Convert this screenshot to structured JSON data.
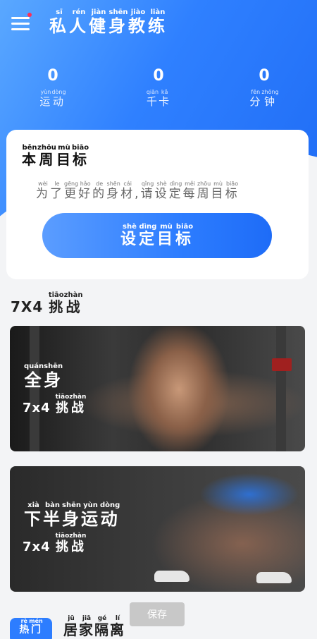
{
  "header": {
    "title_chars": [
      {
        "han": "私",
        "py": "sī"
      },
      {
        "han": "人",
        "py": "rén"
      },
      {
        "han": "健",
        "py": "jiàn"
      },
      {
        "han": "身",
        "py": "shēn"
      },
      {
        "han": "教",
        "py": "jiào"
      },
      {
        "han": "练",
        "py": "liàn"
      }
    ]
  },
  "stats": [
    {
      "value": "0",
      "label_chars": [
        {
          "han": "运",
          "py": "yùn"
        },
        {
          "han": "动",
          "py": "dòng"
        }
      ]
    },
    {
      "value": "0",
      "label_chars": [
        {
          "han": "千",
          "py": "qiān"
        },
        {
          "han": "卡",
          "py": "kǎ"
        }
      ]
    },
    {
      "value": "0",
      "label_chars": [
        {
          "han": "分",
          "py": "fēn"
        },
        {
          "han": "钟",
          "py": "zhōng"
        }
      ]
    }
  ],
  "goal": {
    "title_chars": [
      {
        "han": "本",
        "py": "běn"
      },
      {
        "han": "周",
        "py": "zhōu"
      },
      {
        "han": "目",
        "py": "mù"
      },
      {
        "han": "标",
        "py": "biāo"
      }
    ],
    "subtitle_chars": [
      {
        "han": "为",
        "py": "wèi"
      },
      {
        "han": "了",
        "py": "le"
      },
      {
        "han": "更",
        "py": "gēng"
      },
      {
        "han": "好",
        "py": "hǎo"
      },
      {
        "han": "的",
        "py": "de"
      },
      {
        "han": "身",
        "py": "shēn"
      },
      {
        "han": "材",
        "py": "cái"
      },
      {
        "han": ",",
        "py": ""
      },
      {
        "han": "请",
        "py": "qǐng"
      },
      {
        "han": "设",
        "py": "shè"
      },
      {
        "han": "定",
        "py": "dìng"
      },
      {
        "han": "每",
        "py": "měi"
      },
      {
        "han": "周",
        "py": "zhōu"
      },
      {
        "han": "目",
        "py": "mù"
      },
      {
        "han": "标",
        "py": "biāo"
      }
    ],
    "button_chars": [
      {
        "han": "设",
        "py": "shè"
      },
      {
        "han": "定",
        "py": "dìng"
      },
      {
        "han": "目",
        "py": "mù"
      },
      {
        "han": "标",
        "py": "biāo"
      }
    ]
  },
  "challenge_section": {
    "prefix": "7X4",
    "title_chars": [
      {
        "han": "挑",
        "py": "tiāo"
      },
      {
        "han": "战",
        "py": "zhàn"
      }
    ]
  },
  "cards": [
    {
      "title_chars": [
        {
          "han": "全",
          "py": "quán"
        },
        {
          "han": "身",
          "py": "shēn"
        }
      ],
      "sub_prefix": "7x4",
      "sub_chars": [
        {
          "han": "挑",
          "py": "tiāo"
        },
        {
          "han": "战",
          "py": "zhàn"
        }
      ]
    },
    {
      "title_chars": [
        {
          "han": "下",
          "py": "xià"
        },
        {
          "han": "半",
          "py": "bàn"
        },
        {
          "han": "身",
          "py": "shēn"
        },
        {
          "han": "运",
          "py": "yùn"
        },
        {
          "han": "动",
          "py": "dòng"
        }
      ],
      "sub_prefix": "7x4",
      "sub_chars": [
        {
          "han": "挑",
          "py": "tiāo"
        },
        {
          "han": "战",
          "py": "zhàn"
        }
      ]
    }
  ],
  "bottom": {
    "tag_chars": [
      {
        "han": "热",
        "py": "rè"
      },
      {
        "han": "门",
        "py": "mén"
      }
    ],
    "title_chars": [
      {
        "han": "居",
        "py": "jū"
      },
      {
        "han": "家",
        "py": "jiā"
      },
      {
        "han": "隔",
        "py": "gé"
      },
      {
        "han": "离",
        "py": "lí"
      }
    ]
  },
  "save_button_label": "保存"
}
